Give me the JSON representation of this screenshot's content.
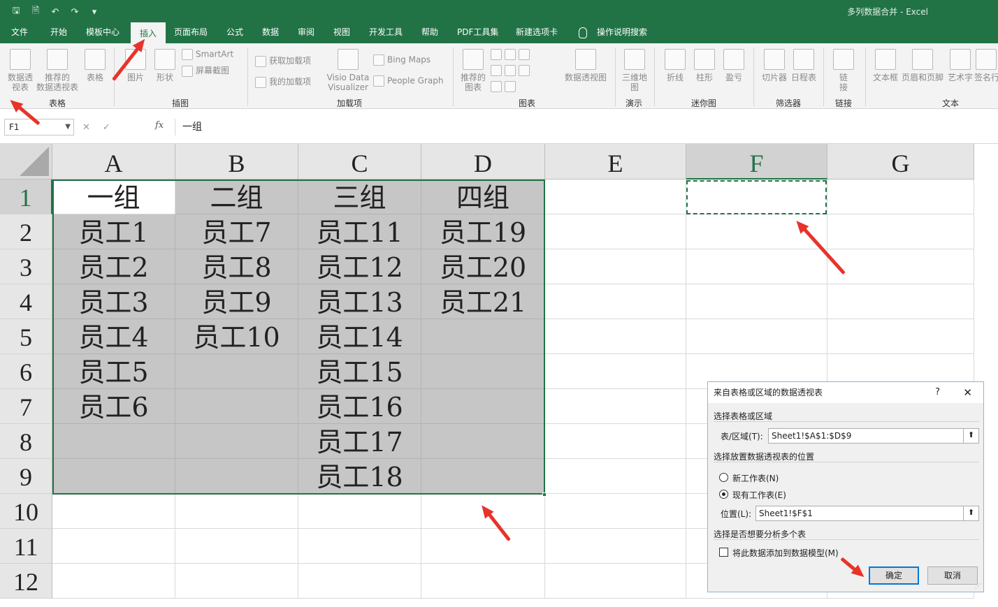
{
  "window": {
    "doc_title": "多列数据合并  -  Excel",
    "qat": {
      "save": "🖫",
      "preview": "🗎",
      "undo": "↶",
      "redo": "↷",
      "customize": "▾"
    }
  },
  "tabs": [
    {
      "label": "文件",
      "active": false
    },
    {
      "label": "开始",
      "active": false
    },
    {
      "label": "模板中心",
      "active": false
    },
    {
      "label": "插入",
      "active": true
    },
    {
      "label": "页面布局",
      "active": false
    },
    {
      "label": "公式",
      "active": false
    },
    {
      "label": "数据",
      "active": false
    },
    {
      "label": "审阅",
      "active": false
    },
    {
      "label": "视图",
      "active": false
    },
    {
      "label": "开发工具",
      "active": false
    },
    {
      "label": "帮助",
      "active": false
    },
    {
      "label": "PDF工具集",
      "active": false
    },
    {
      "label": "新建选项卡",
      "active": false
    },
    {
      "label": "操作说明搜索",
      "active": false
    }
  ],
  "ribbon": {
    "pivot_line1": "数据透",
    "pivot_line2": "视表",
    "rec_pivot_line1": "推荐的",
    "rec_pivot_line2": "数据透视表",
    "table": "表格",
    "picture": "图片",
    "shapes": "形状",
    "smartart": "SmartArt",
    "screenshot": "屏幕截图",
    "get_addins": "获取加载项",
    "my_addins": "我的加载项",
    "visio_line1": "Visio Data",
    "visio_line2": "Visualizer",
    "bing_maps": "Bing Maps",
    "people_graph": "People Graph",
    "rec_charts_line1": "推荐的",
    "rec_charts_line2": "图表",
    "pivot_chart": "数据透视图",
    "map3d_line1": "三维地",
    "map3d_line2": "图",
    "line": "折线",
    "column": "柱形",
    "winloss": "盈亏",
    "slicer": "切片器",
    "timeline": "日程表",
    "link_line1": "链",
    "link_line2": "接",
    "textbox": "文本框",
    "header_footer": "页眉和页脚",
    "wordart": "艺术字",
    "signature": "签名行",
    "groups": {
      "tables": "表格",
      "illustrations": "插图",
      "addins": "加载项",
      "charts": "图表",
      "tours": "演示",
      "sparklines": "迷你图",
      "filters": "筛选器",
      "links": "链接",
      "text": "文本"
    }
  },
  "formula_bar": {
    "name_box": "F1",
    "cancel": "✕",
    "enter": "✓",
    "fx": "fx",
    "content": "一组"
  },
  "sheet": {
    "columns": [
      "A",
      "B",
      "C",
      "D",
      "E",
      "F",
      "G"
    ],
    "rows": [
      "1",
      "2",
      "3",
      "4",
      "5",
      "6",
      "7",
      "8",
      "9",
      "10",
      "11",
      "12"
    ],
    "cells": [
      [
        "一组",
        "二组",
        "三组",
        "四组"
      ],
      [
        "员工1",
        "员工7",
        "员工11",
        "员工19"
      ],
      [
        "员工2",
        "员工8",
        "员工12",
        "员工20"
      ],
      [
        "员工3",
        "员工9",
        "员工13",
        "员工21"
      ],
      [
        "员工4",
        "员工10",
        "员工14",
        ""
      ],
      [
        "员工5",
        "",
        "员工15",
        ""
      ],
      [
        "员工6",
        "",
        "员工16",
        ""
      ],
      [
        "",
        "",
        "员工17",
        ""
      ],
      [
        "",
        "",
        "员工18",
        ""
      ]
    ],
    "colors": {
      "selection": "#217346",
      "shade": "#c6c6c6",
      "arrow": "#e8332a"
    }
  },
  "dialog": {
    "title": "来自表格或区域的数据透视表",
    "help": "?",
    "close": "✕",
    "section_table": "选择表格或区域",
    "range_label": "表/区域(T):",
    "range_value": "Sheet1!$A$1:$D$9",
    "section_location": "选择放置数据透视表的位置",
    "new_sheet": "新工作表(N)",
    "existing_sheet": "现有工作表(E)",
    "location_label": "位置(L):",
    "location_value": "Sheet1!$F$1",
    "section_multi": "选择是否想要分析多个表",
    "add_model": "将此数据添加到数据模型(M)",
    "ok": "确定",
    "cancel": "取消",
    "selected_option": "existing_sheet",
    "add_model_checked": false
  }
}
